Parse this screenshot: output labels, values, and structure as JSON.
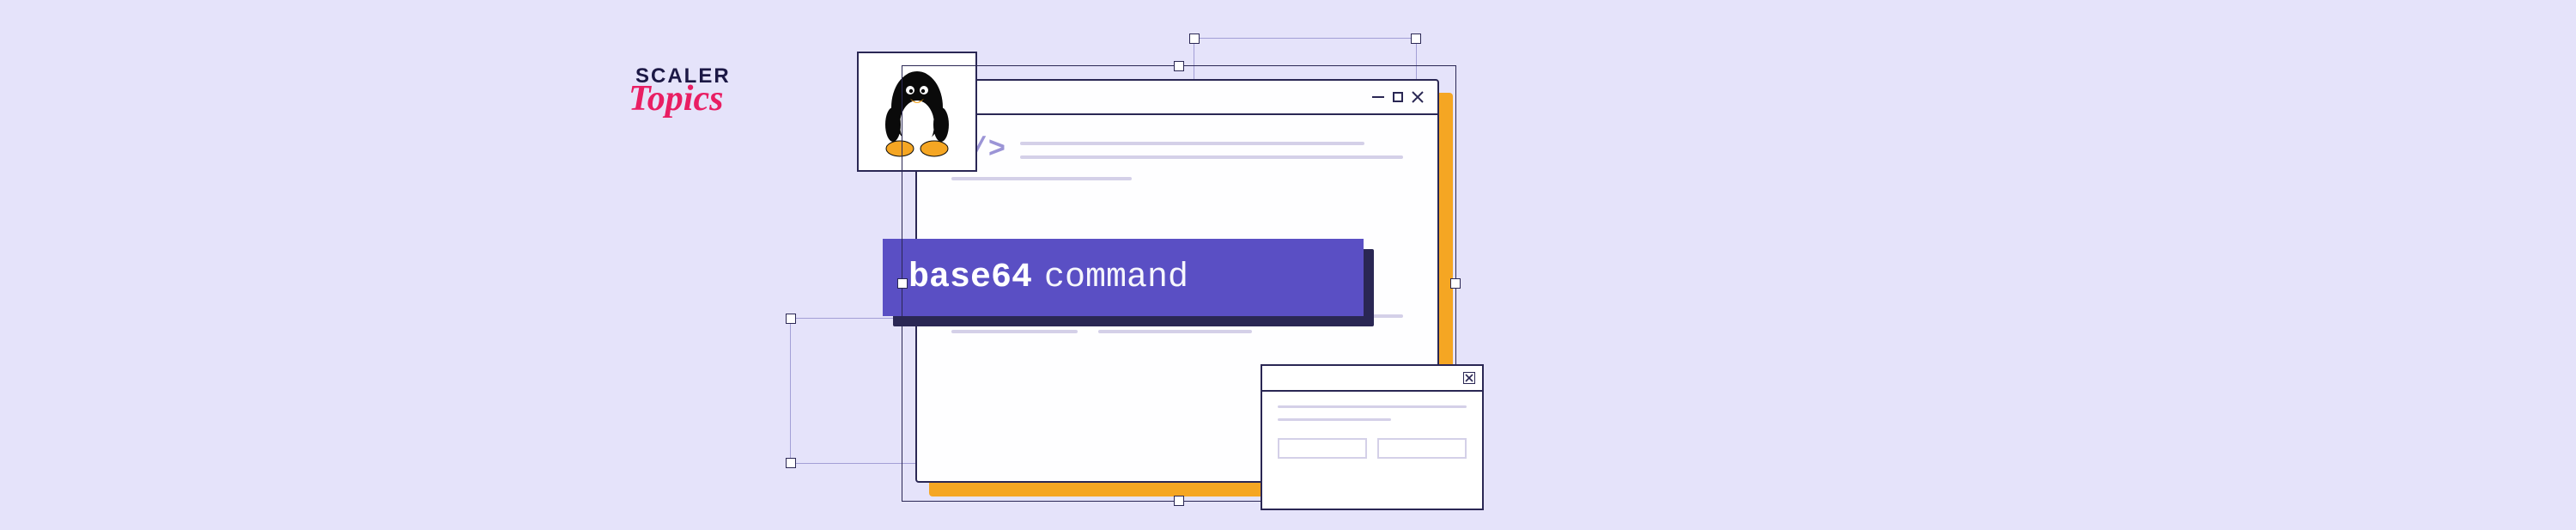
{
  "logo": {
    "line1": "SCALER",
    "line2": "Topics"
  },
  "main_window": {
    "code_tag": "</>",
    "controls": {
      "min": "minimize",
      "max": "maximize",
      "close": "close"
    }
  },
  "command": {
    "cmd": "base64",
    "arg": "command"
  },
  "tux": {
    "label": "tux-linux-mascot"
  },
  "dialog": {
    "close": "×"
  }
}
